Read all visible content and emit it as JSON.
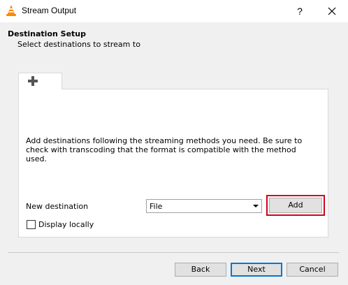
{
  "window": {
    "title": "Stream Output",
    "help_label": "?",
    "app_icon": "vlc-cone-icon",
    "close_icon": "close-icon"
  },
  "header": {
    "title": "Destination Setup",
    "subtitle": "Select destinations to stream to"
  },
  "tab": {
    "icon": "plus-icon"
  },
  "panel": {
    "description": "Add destinations following the streaming methods you need. Be sure to check with transcoding that the format is compatible with the method used.",
    "new_destination_label": "New destination",
    "destination_select": {
      "selected": "File"
    },
    "add_label": "Add",
    "display_locally_label": "Display locally",
    "display_locally_checked": false
  },
  "footer": {
    "back_label": "Back",
    "next_label": "Next",
    "cancel_label": "Cancel"
  },
  "colors": {
    "highlight": "#d0021b",
    "primary_border": "#0078d7",
    "vlc_orange": "#ff8800"
  }
}
